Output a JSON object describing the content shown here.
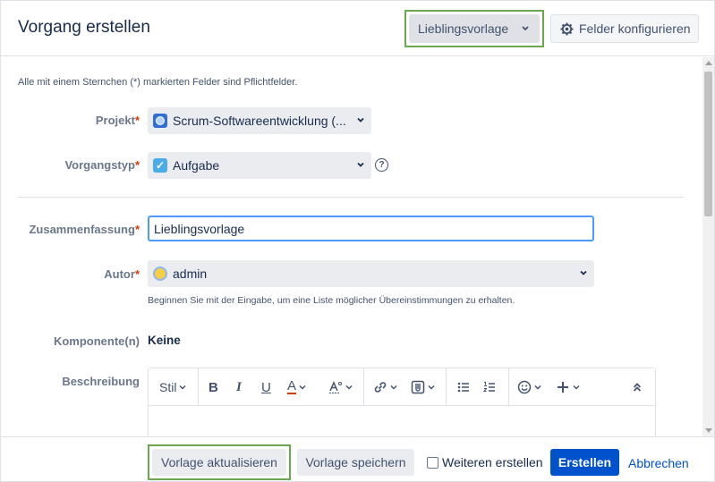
{
  "header": {
    "title": "Vorgang erstellen",
    "favorite_dropdown": "Lieblingsvorlage",
    "configure_button": "Felder konfigurieren"
  },
  "form": {
    "required_note": "Alle mit einem Sternchen (*) markierten Felder sind Pflichtfelder.",
    "project": {
      "label": "Projekt",
      "value": "Scrum-Softwareentwicklung (..."
    },
    "issue_type": {
      "label": "Vorgangstyp",
      "value": "Aufgabe",
      "help": "?"
    },
    "summary": {
      "label": "Zusammenfassung",
      "value": "Lieblingsvorlage"
    },
    "author": {
      "label": "Autor",
      "value": "admin",
      "hint": "Beginnen Sie mit der Eingabe, um eine Liste möglicher Übereinstimmungen zu erhalten."
    },
    "component": {
      "label": "Komponente(n)",
      "value": "Keine"
    },
    "description": {
      "label": "Beschreibung",
      "toolbar": {
        "style": "Stil",
        "bold": "B",
        "italic": "I",
        "underline": "U",
        "text_color": "A"
      }
    },
    "required_marker": "*"
  },
  "footer": {
    "update_template": "Vorlage aktualisieren",
    "save_template": "Vorlage speichern",
    "create_another": "Weiteren erstellen",
    "create": "Erstellen",
    "cancel": "Abbrechen"
  },
  "colors": {
    "accent": "#0052cc",
    "highlight": "#6aa84f",
    "required": "#de350b"
  },
  "icons": [
    "gear-icon",
    "chevron-down-icon",
    "project-avatar-icon",
    "task-checkbox-icon",
    "help-icon",
    "user-avatar-icon",
    "bold-icon",
    "italic-icon",
    "underline-icon",
    "text-color-icon",
    "text-style-icon",
    "link-icon",
    "attachment-icon",
    "bullet-list-icon",
    "numbered-list-icon",
    "emoji-icon",
    "insert-plus-icon",
    "collapse-toolbar-icon"
  ]
}
